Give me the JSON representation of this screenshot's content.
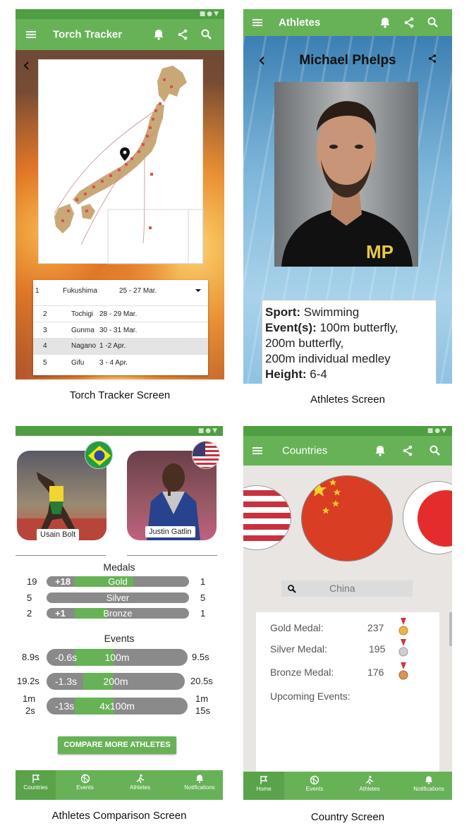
{
  "torch": {
    "title": "Torch Tracker",
    "caption": "Torch Tracker Screen",
    "selected": {
      "num": "1",
      "place": "Fukushima",
      "dates": "25 - 27 Mar."
    },
    "rows": [
      {
        "num": "2",
        "place": "Tochigi",
        "dates": "28 - 29 Mar."
      },
      {
        "num": "3",
        "place": "Gunma",
        "dates": "30 - 31 Mar."
      },
      {
        "num": "4",
        "place": "Nagano",
        "dates": "1 -2 Apr."
      },
      {
        "num": "5",
        "place": "Gifu",
        "dates": "3 - 4 Apr."
      }
    ]
  },
  "athlete": {
    "title": "Athletes",
    "caption": "Athletes Screen",
    "name": "Michael Phelps",
    "sport_label": "Sport:",
    "sport": "Swimming",
    "events_label": "Event(s):",
    "events_line1": "100m butterfly,",
    "events_line2": "200m butterfly,",
    "events_line3": "200m individual medley",
    "height_label": "Height:",
    "height": "6-4",
    "logo_text": "MP"
  },
  "comparison": {
    "caption": "Athletes Comparison Screen",
    "athlete_left": "Usain Bolt",
    "athlete_right": "Justin Gatlin",
    "medals_heading": "Medals",
    "events_heading": "Events",
    "medals": [
      {
        "left": "19",
        "right": "1",
        "label": "Gold",
        "diff": "+18",
        "fill_fraction": 0.55
      },
      {
        "left": "5",
        "right": "5",
        "label": "Silver",
        "diff": "",
        "fill_fraction": 0
      },
      {
        "left": "2",
        "right": "1",
        "label": "Bronze",
        "diff": "+1",
        "fill_fraction": 0.3
      }
    ],
    "events": [
      {
        "left": "8.9s",
        "right": "9.5s",
        "label": "100m",
        "diff": "-0.6s",
        "fill_fraction": 0.5
      },
      {
        "left": "19.2s",
        "right": "20.5s",
        "label": "200m",
        "diff": "-1.3s",
        "fill_fraction": 0.38
      },
      {
        "left_a": "1m",
        "left_b": "2s",
        "right_a": "1m",
        "right_b": "15s",
        "label": "4x100m",
        "diff": "-13s",
        "fill_fraction": 0.5
      }
    ],
    "button": "COMPARE MORE ATHLETES",
    "nav": [
      "Countries",
      "Events",
      "Athletes",
      "Notifications"
    ]
  },
  "country": {
    "title": "Countries",
    "caption": "Country Screen",
    "search_value": "China",
    "gold_label": "Gold Medal:",
    "gold": "237",
    "silver_label": "Silver Medal:",
    "silver": "195",
    "bronze_label": "Bronze Medal:",
    "bronze": "176",
    "upcoming_label": "Upcoming Events:",
    "nav": [
      "Home",
      "Events",
      "Athletes",
      "Notifications"
    ]
  },
  "colors": {
    "primary": "#67b257",
    "status": "#4f9e43",
    "bar": "#8a8a8a"
  }
}
